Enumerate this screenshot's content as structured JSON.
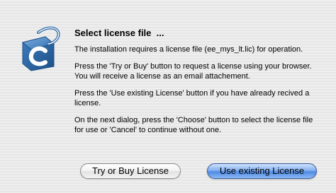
{
  "dialog": {
    "title": "Select license file  ...",
    "paragraphs": [
      "The installation requires a license file (ee_mys_lt.lic) for operation.",
      "Press the 'Try or Buy' button to request a license using your browser. You will receive a license as an email attachement.",
      "Press the 'Use existing License' button if you have already recived a license.",
      "On the next dialog, press the 'Choose' button to select the license file for use or 'Cancel' to continue without one."
    ],
    "icon": "app-logo-icon",
    "buttons": {
      "try_or_buy": "Try or Buy License",
      "use_existing": "Use existing License"
    }
  },
  "colors": {
    "background": "#ececec",
    "default_button": "#4f8ae2",
    "logo_blue": "#2f6aa8"
  }
}
